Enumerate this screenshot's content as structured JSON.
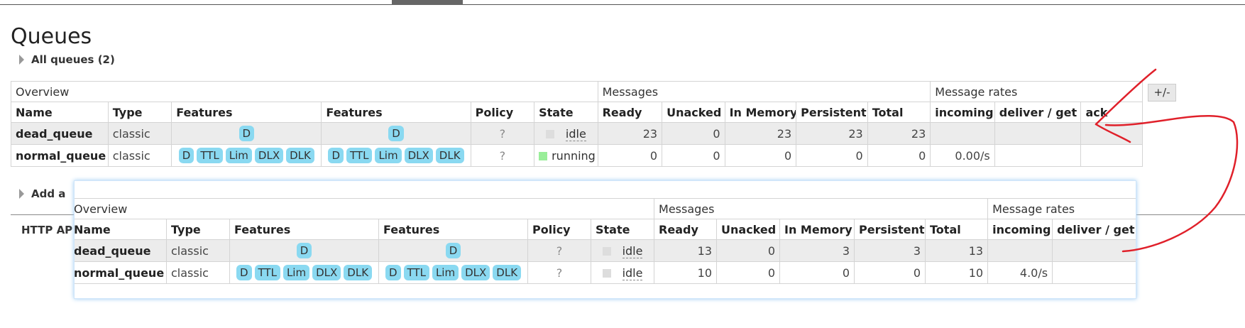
{
  "page": {
    "title": "Queues"
  },
  "sections": {
    "all_queues": "All queues (2)",
    "add_queue": "Add a",
    "http_api": "HTTP AP"
  },
  "toggle_label": "+/-",
  "table_top": {
    "group_headers": [
      "Overview",
      "Messages",
      "Message rates"
    ],
    "columns": [
      "Name",
      "Type",
      "Features",
      "Features",
      "Policy",
      "State",
      "Ready",
      "Unacked",
      "In Memory",
      "Persistent",
      "Total",
      "incoming",
      "deliver / get",
      "ack"
    ],
    "rows": [
      {
        "name": "dead_queue",
        "type": "classic",
        "features1": [
          "D"
        ],
        "features2": [
          "D"
        ],
        "policy": "?",
        "state": "idle",
        "state_color": "#dddddd",
        "ready": "23",
        "unacked": "0",
        "in_memory": "23",
        "persistent": "23",
        "total": "23",
        "incoming": "",
        "deliver_get": "",
        "ack": ""
      },
      {
        "name": "normal_queue",
        "type": "classic",
        "features1": [
          "D",
          "TTL",
          "Lim",
          "DLX",
          "DLK"
        ],
        "features2": [
          "D",
          "TTL",
          "Lim",
          "DLX",
          "DLK"
        ],
        "policy": "?",
        "state": "running",
        "state_color": "#99ee99",
        "ready": "0",
        "unacked": "0",
        "in_memory": "0",
        "persistent": "0",
        "total": "0",
        "incoming": "0.00/s",
        "deliver_get": "",
        "ack": ""
      }
    ]
  },
  "table_overlay": {
    "group_headers": [
      "Overview",
      "Messages",
      "Message rates"
    ],
    "columns": [
      "Name",
      "Type",
      "Features",
      "Features",
      "Policy",
      "State",
      "Ready",
      "Unacked",
      "In Memory",
      "Persistent",
      "Total",
      "incoming",
      "deliver / get"
    ],
    "rows": [
      {
        "name": "dead_queue",
        "type": "classic",
        "features1": [
          "D"
        ],
        "features2": [
          "D"
        ],
        "policy": "?",
        "state": "idle",
        "state_color": "#dddddd",
        "ready": "13",
        "unacked": "0",
        "in_memory": "3",
        "persistent": "3",
        "total": "13",
        "incoming": "",
        "deliver_get": ""
      },
      {
        "name": "normal_queue",
        "type": "classic",
        "features1": [
          "D",
          "TTL",
          "Lim",
          "DLX",
          "DLK"
        ],
        "features2": [
          "D",
          "TTL",
          "Lim",
          "DLX",
          "DLK"
        ],
        "policy": "?",
        "state": "idle",
        "state_color": "#dddddd",
        "ready": "10",
        "unacked": "0",
        "in_memory": "0",
        "persistent": "0",
        "total": "10",
        "incoming": "4.0/s",
        "deliver_get": ""
      }
    ]
  },
  "colors": {
    "tag_bg": "#8ad9f1",
    "annotation_red": "#e0202a",
    "row_alt": "#ececec"
  }
}
